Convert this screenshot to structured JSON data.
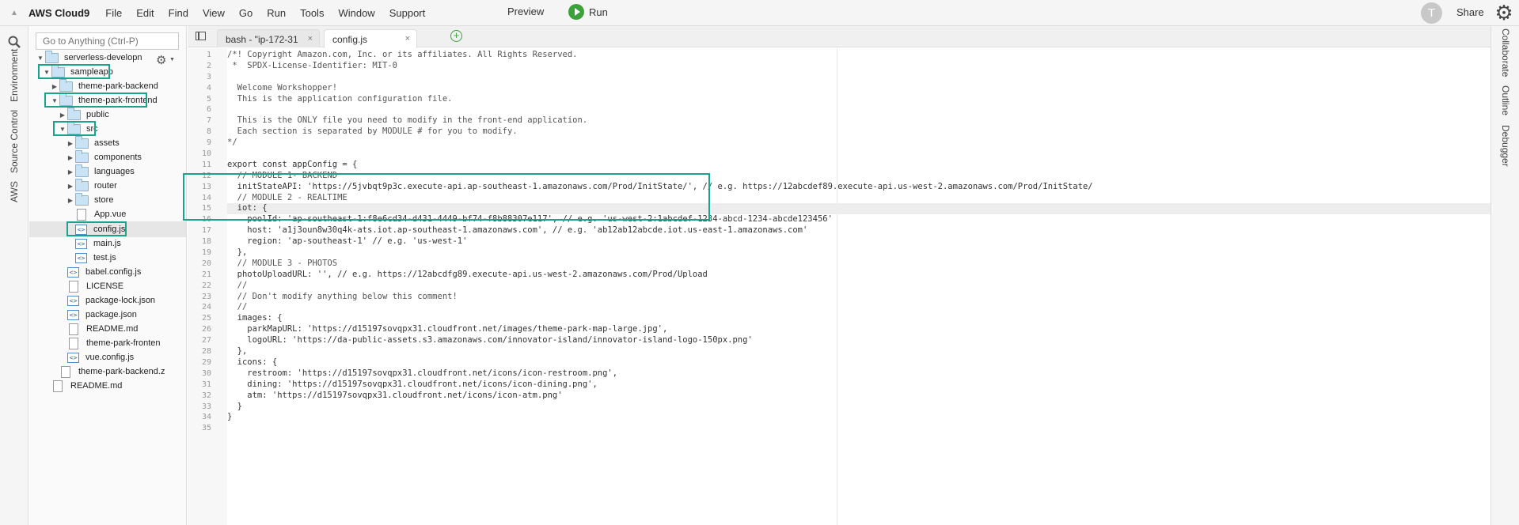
{
  "menubar": {
    "brand": "AWS Cloud9",
    "menus": [
      "File",
      "Edit",
      "Find",
      "View",
      "Go",
      "Run",
      "Tools",
      "Window",
      "Support"
    ],
    "preview": "Preview",
    "run": "Run",
    "avatar_letter": "T",
    "share": "Share"
  },
  "left_tabs": [
    "Environment",
    "Source Control",
    "AWS"
  ],
  "right_tabs": [
    "Collaborate",
    "Outline",
    "Debugger"
  ],
  "tree": {
    "goto_placeholder": "Go to Anything (Ctrl-P)",
    "items": [
      {
        "label": "serverless-developn",
        "type": "folder",
        "expanded": true
      },
      {
        "label": "sampleapp",
        "type": "folder",
        "expanded": true
      },
      {
        "label": "theme-park-backend",
        "type": "folder",
        "expanded": false
      },
      {
        "label": "theme-park-frontend",
        "type": "folder",
        "expanded": true
      },
      {
        "label": "public",
        "type": "folder",
        "expanded": false
      },
      {
        "label": "src",
        "type": "folder",
        "expanded": true
      },
      {
        "label": "assets",
        "type": "folder",
        "expanded": false
      },
      {
        "label": "components",
        "type": "folder",
        "expanded": false
      },
      {
        "label": "languages",
        "type": "folder",
        "expanded": false
      },
      {
        "label": "router",
        "type": "folder",
        "expanded": false
      },
      {
        "label": "store",
        "type": "folder",
        "expanded": false
      },
      {
        "label": "App.vue",
        "type": "doc"
      },
      {
        "label": "config.js",
        "type": "code"
      },
      {
        "label": "main.js",
        "type": "code"
      },
      {
        "label": "test.js",
        "type": "code"
      },
      {
        "label": "babel.config.js",
        "type": "code"
      },
      {
        "label": "LICENSE",
        "type": "doc"
      },
      {
        "label": "package-lock.json",
        "type": "code"
      },
      {
        "label": "package.json",
        "type": "code"
      },
      {
        "label": "README.md",
        "type": "doc"
      },
      {
        "label": "theme-park-fronten",
        "type": "doc"
      },
      {
        "label": "vue.config.js",
        "type": "code"
      },
      {
        "label": "theme-park-backend.z",
        "type": "doc"
      },
      {
        "label": "README.md",
        "type": "doc"
      }
    ]
  },
  "tabs": {
    "bash": "bash - \"ip-172-31",
    "active": "config.js",
    "close": "×",
    "add": "+"
  },
  "code_lines": [
    "/*! Copyright Amazon.com, Inc. or its affiliates. All Rights Reserved.",
    " *  SPDX-License-Identifier: MIT-0",
    "",
    "  Welcome Workshopper!",
    "  This is the application configuration file.",
    "",
    "  This is the ONLY file you need to modify in the front-end application.",
    "  Each section is separated by MODULE # for you to modify.",
    "*/",
    "",
    "export const appConfig = {",
    "  // MODULE 1- BACKEND",
    "  initStateAPI: 'https://5jvbqt9p3c.execute-api.ap-southeast-1.amazonaws.com/Prod/InitState/', // e.g. https://12abcdef89.execute-api.us-west-2.amazonaws.com/Prod/InitState/",
    "  // MODULE 2 - REALTIME",
    "  iot: {",
    "    poolId: 'ap-southeast-1:f8e6cd34-d431-4449-bf74-f8b88307e117', // e.g. 'us-west-2:1abcdef-1234-abcd-1234-abcde123456'",
    "    host: 'a1j3oun8w30q4k-ats.iot.ap-southeast-1.amazonaws.com', // e.g. 'ab12ab12abcde.iot.us-east-1.amazonaws.com'",
    "    region: 'ap-southeast-1' // e.g. 'us-west-1'",
    "  },",
    "  // MODULE 3 - PHOTOS",
    "  photoUploadURL: '', // e.g. https://12abcdfg89.execute-api.us-west-2.amazonaws.com/Prod/Upload",
    "  //",
    "  // Don't modify anything below this comment!",
    "  //",
    "  images: {",
    "    parkMapURL: 'https://d15197sovqpx31.cloudfront.net/images/theme-park-map-large.jpg',",
    "    logoURL: 'https://da-public-assets.s3.amazonaws.com/innovator-island/innovator-island-logo-150px.png'",
    "  },",
    "  icons: {",
    "    restroom: 'https://d15197sovqpx31.cloudfront.net/icons/icon-restroom.png',",
    "    dining: 'https://d15197sovqpx31.cloudfront.net/icons/icon-dining.png',",
    "    atm: 'https://d15197sovqpx31.cloudfront.net/icons/icon-atm.png'",
    "  }",
    "}",
    ""
  ],
  "colors": {
    "highlight": "#1aa38a",
    "run_green": "#3ba13b"
  }
}
